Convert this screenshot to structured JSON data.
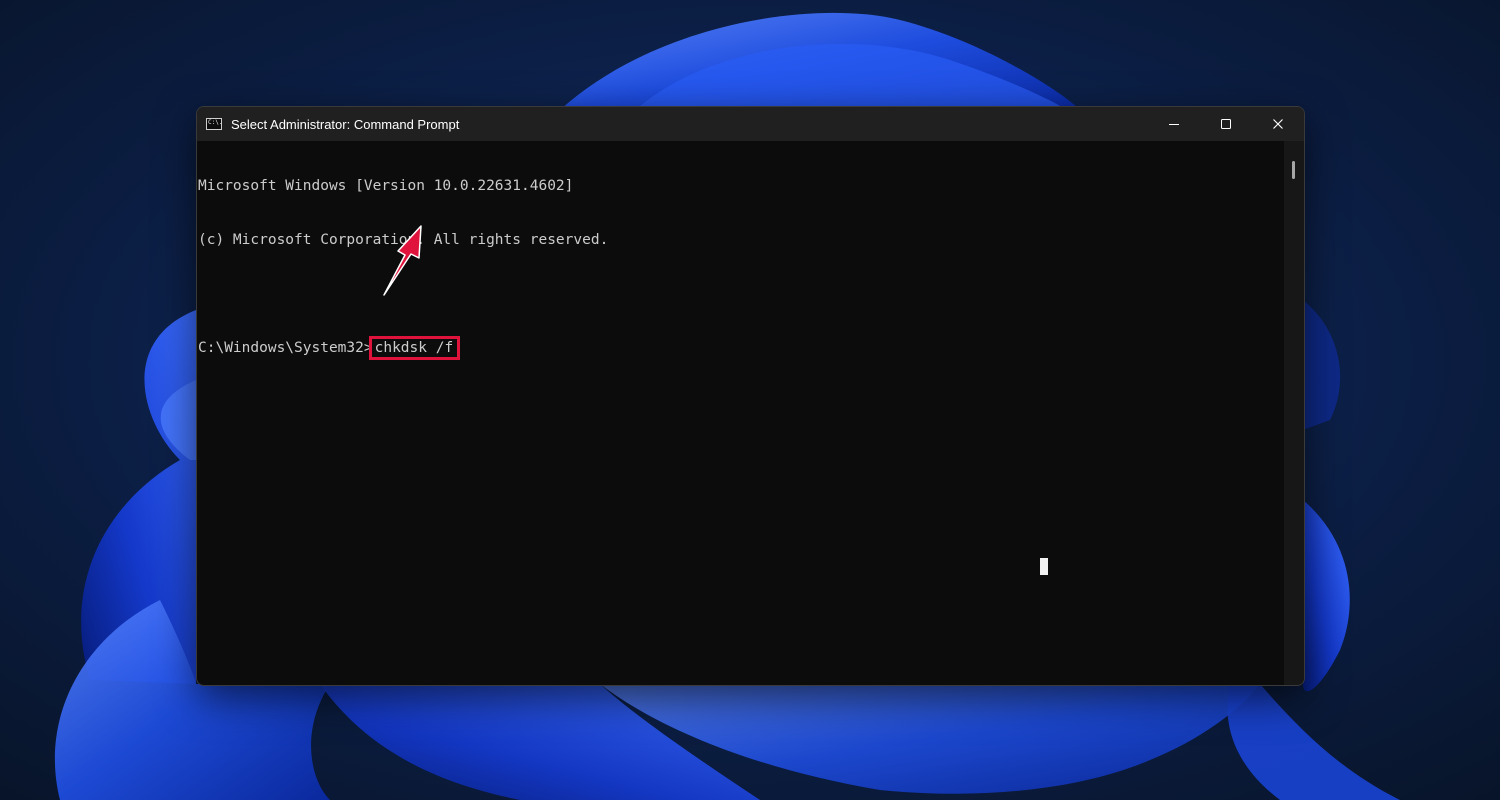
{
  "window": {
    "title": "Select Administrator: Command Prompt",
    "icon": "command-prompt-icon",
    "icon_text": "C:\\.",
    "controls": [
      "minimize-icon",
      "maximize-icon",
      "close-icon"
    ]
  },
  "console": {
    "lines": [
      "Microsoft Windows [Version 10.0.22631.4602]",
      "(c) Microsoft Corporation. All rights reserved.",
      ""
    ],
    "prompt": "C:\\Windows\\System32>",
    "command": "chkdsk /f"
  },
  "annotation": {
    "highlight_color": "#e0133c",
    "arrow": "red-arrow-icon"
  },
  "colors": {
    "console_bg": "#0c0c0c",
    "console_text": "#cccccc",
    "titlebar_bg": "#202020",
    "wallpaper_dark": "#0b1a33",
    "wallpaper_bloom": "#1e4fe0"
  }
}
